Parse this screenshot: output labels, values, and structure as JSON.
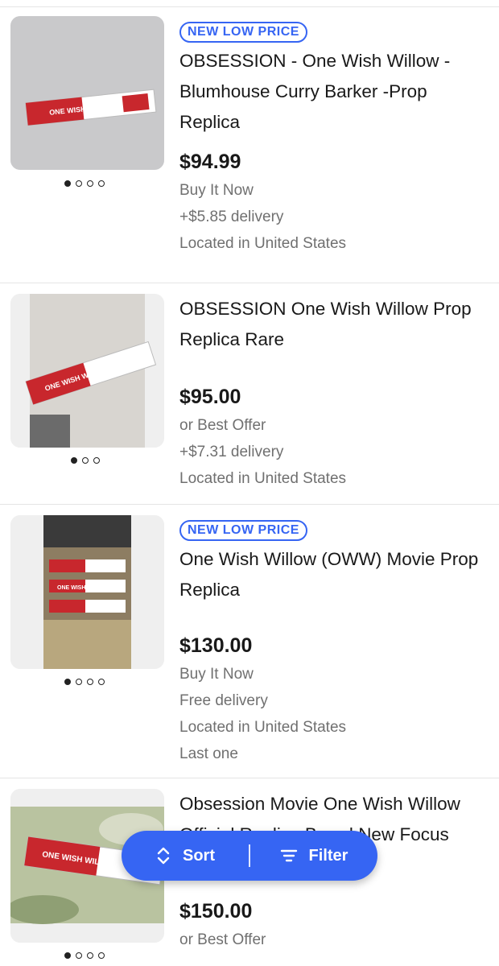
{
  "listings": [
    {
      "badge": "NEW LOW PRICE",
      "title_lines": [
        "OBSESSION - One Wish Willow -",
        "Blumhouse Curry Barker -Prop",
        "Replica"
      ],
      "price": "$94.99",
      "format": "Buy It Now",
      "delivery": "+$5.85 delivery",
      "location": "Located in United States",
      "image_text": "ONE WISH WILLOW",
      "image_dots": 4,
      "active_dot": 0
    },
    {
      "title_lines": [
        "OBSESSION One Wish Willow Prop",
        "Replica Rare"
      ],
      "price": "$95.00",
      "format": "or Best Offer",
      "delivery": "+$7.31 delivery",
      "location": "Located in United States",
      "image_text": "ONE WISH WILLOW",
      "image_dots": 3,
      "active_dot": 0
    },
    {
      "badge": "NEW LOW PRICE",
      "title_lines": [
        "One Wish Willow (OWW) Movie Prop",
        "Replica"
      ],
      "price": "$130.00",
      "format": "Buy It Now",
      "delivery": "Free delivery",
      "location": "Located in United States",
      "note": "Last one",
      "image_text": "ONE WISH WILLOW",
      "image_dots": 4,
      "active_dot": 0
    },
    {
      "title_lines": [
        "Obsession Movie One Wish Willow",
        "Official Replica Brand New Focus"
      ],
      "price": "$150.00",
      "format": "or Best Offer",
      "image_text": "ONE WISH WILLOW",
      "image_dots": 4,
      "active_dot": 0
    }
  ],
  "actions": {
    "sort_label": "Sort",
    "filter_label": "Filter"
  },
  "colors": {
    "accent": "#3665f3",
    "text": "#191919",
    "muted": "#707070"
  }
}
